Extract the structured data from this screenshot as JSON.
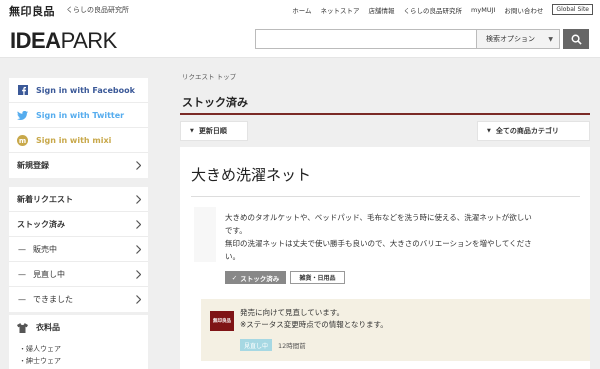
{
  "topbar": {
    "brand": "無印良品",
    "brand_sub": "くらしの良品研究所",
    "nav": [
      "ホーム",
      "ネットストア",
      "店舗情報",
      "くらしの良品研究所",
      "myMUJI",
      "お問い合わせ"
    ],
    "global_site": "Global Site"
  },
  "header": {
    "logo_bold": "IDEA",
    "logo_light": "PARK",
    "search_value": "",
    "search_option": "検索オプション"
  },
  "sidebar": {
    "auth": [
      {
        "label": "Sign in with Facebook",
        "icon": "facebook-icon"
      },
      {
        "label": "Sign in with Twitter",
        "icon": "twitter-icon"
      },
      {
        "label": "Sign in with mixi",
        "icon": "mixi-icon"
      },
      {
        "label": "新規登録"
      }
    ],
    "requests": [
      {
        "label": "新着リクエスト"
      },
      {
        "label": "ストック済み"
      },
      {
        "label": "販売中"
      },
      {
        "label": "見直し中"
      },
      {
        "label": "できました"
      }
    ],
    "category": {
      "title": "衣料品",
      "items": [
        "婦人ウェア",
        "紳士ウェア"
      ]
    }
  },
  "main": {
    "breadcrumb": "リクエスト トップ",
    "section_title": "ストック済み",
    "filter_date": "更新日順",
    "filter_category": "全ての商品カテゴリ",
    "card": {
      "title": "大きめ洗濯ネット",
      "body_lines": [
        "大きめのタオルケットや、ベッドパッド、毛布などを洗う時に使える、洗濯ネットが欲しい",
        "です。",
        "無印の洗濯ネットは丈夫で使い勝手も良いので、大きさのバリエーションを増やしてくださ",
        "い。"
      ],
      "stock_button": "ストック済み",
      "category_button": "雑貨・日用品",
      "status": {
        "logo_text": "無印良品",
        "lines": [
          "発売に向けて見直しています。",
          "※ステータス変更時点での情報となります。"
        ],
        "badge": "見直し中",
        "time": "12時間前"
      }
    }
  },
  "colors": {
    "accent": "#7a2a26",
    "facebook": "#3b5998",
    "twitter": "#55acee",
    "mixi": "#c8a84a",
    "status_bg": "#f4f0e3",
    "badge": "#a6d8e3"
  }
}
